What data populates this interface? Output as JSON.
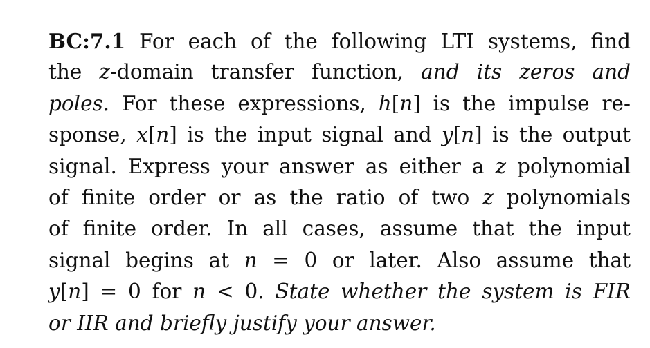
{
  "problem": {
    "label": "BC:7.1",
    "lines": [
      [
        {
          "t": "BC:7.1",
          "s": "bold"
        },
        {
          "t": " For each of the following LTI systems, find",
          "s": ""
        }
      ],
      [
        {
          "t": "the ",
          "s": ""
        },
        {
          "t": "z",
          "s": "math"
        },
        {
          "t": "-domain transfer function, ",
          "s": ""
        },
        {
          "t": "and its zeros and",
          "s": "it"
        }
      ],
      [
        {
          "t": "poles.",
          "s": "it"
        },
        {
          "t": " For these expressions, ",
          "s": ""
        },
        {
          "t": "h",
          "s": "math"
        },
        {
          "t": "[",
          "s": ""
        },
        {
          "t": "n",
          "s": "math"
        },
        {
          "t": "] is the impulse re-",
          "s": ""
        }
      ],
      [
        {
          "t": "sponse, ",
          "s": ""
        },
        {
          "t": "x",
          "s": "math"
        },
        {
          "t": "[",
          "s": ""
        },
        {
          "t": "n",
          "s": "math"
        },
        {
          "t": "] is the input signal and ",
          "s": ""
        },
        {
          "t": "y",
          "s": "math"
        },
        {
          "t": "[",
          "s": ""
        },
        {
          "t": "n",
          "s": "math"
        },
        {
          "t": "] is the output",
          "s": ""
        }
      ],
      [
        {
          "t": "signal. Express your answer as either a ",
          "s": ""
        },
        {
          "t": "z",
          "s": "math"
        },
        {
          "t": " polynomial",
          "s": ""
        }
      ],
      [
        {
          "t": "of finite order or as the ratio of two ",
          "s": ""
        },
        {
          "t": "z",
          "s": "math"
        },
        {
          "t": " polynomials",
          "s": ""
        }
      ],
      [
        {
          "t": "of finite order.  In all cases, assume that the input",
          "s": ""
        }
      ],
      [
        {
          "t": "signal begins at ",
          "s": ""
        },
        {
          "t": "n",
          "s": "math"
        },
        {
          "t": " = 0 or later.  Also assume that",
          "s": ""
        }
      ],
      [
        {
          "t": "y",
          "s": "math"
        },
        {
          "t": "[",
          "s": ""
        },
        {
          "t": "n",
          "s": "math"
        },
        {
          "t": "] = 0 for ",
          "s": ""
        },
        {
          "t": "n",
          "s": "math"
        },
        {
          "t": " < 0. ",
          "s": ""
        },
        {
          "t": "State whether the system is FIR",
          "s": "it"
        }
      ],
      [
        {
          "t": "or IIR and briefly justify your answer.",
          "s": "it"
        }
      ]
    ]
  }
}
